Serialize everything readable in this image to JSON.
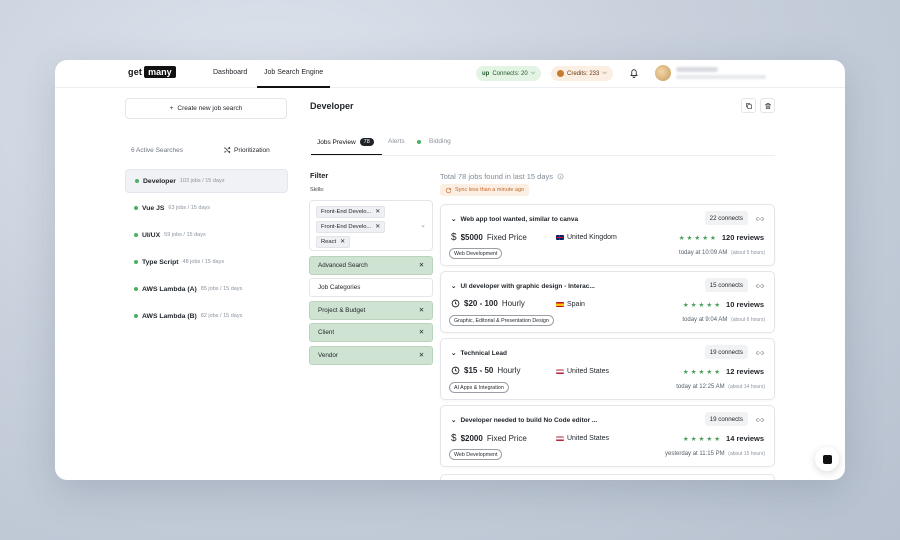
{
  "header": {
    "logo_get": "get",
    "logo_many": "many",
    "nav": [
      "Dashboard",
      "Job Search Engine"
    ],
    "connects": {
      "badge": "up",
      "label": "Connects: 20"
    },
    "credits": {
      "label": "Credits: 233"
    }
  },
  "sidebar": {
    "create_label": "Create new job search",
    "active_label": "6 Active Searches",
    "prioritization_label": "Prioritization",
    "items": [
      {
        "name": "Developer",
        "meta": "103 jobs / 15 days"
      },
      {
        "name": "Vue JS",
        "meta": "63 jobs / 15 days"
      },
      {
        "name": "UI/UX",
        "meta": "59 jobs / 15 days"
      },
      {
        "name": "Type Script",
        "meta": "48 jobs / 15 days"
      },
      {
        "name": "AWS Lambda (A)",
        "meta": "85 jobs / 15 days"
      },
      {
        "name": "AWS Lambda (B)",
        "meta": "82 jobs / 15 days"
      }
    ]
  },
  "main": {
    "title": "Developer",
    "tabs": {
      "jobs_preview": "Jobs Preview",
      "jobs_count": "78",
      "alerts": "Alerts",
      "bidding": "Bidding"
    }
  },
  "filter": {
    "title": "Filter",
    "skills_label": "Skills:",
    "chips": [
      "Front-End Develo...",
      "Front-End Develo...",
      "React"
    ],
    "rows": [
      {
        "label": "Advanced Search",
        "active": true
      },
      {
        "label": "Job Categories",
        "active": false
      },
      {
        "label": "Project & Budget",
        "active": true
      },
      {
        "label": "Client",
        "active": true
      },
      {
        "label": "Vendor",
        "active": true
      }
    ]
  },
  "jobs": {
    "total_label": "Total 78 jobs found in last 15 days",
    "sync_label": "Sync less than a minute ago",
    "list": [
      {
        "title": "Web app tool wanted, similar to canva",
        "connects": "22 connects",
        "price": "$5000",
        "price_type": "Fixed Price",
        "price_icon": "dollar-icon",
        "country": "United Kingdom",
        "flag": "uk",
        "reviews": "120 reviews",
        "category": "Web Development",
        "time": "today at 10:09 AM",
        "ago": "(about 5 hours)"
      },
      {
        "title": "UI developer with graphic design - Interac...",
        "connects": "15 connects",
        "price": "$20 - 100",
        "price_type": "Hourly",
        "price_icon": "clock-icon",
        "country": "Spain",
        "flag": "es",
        "reviews": "10 reviews",
        "category": "Graphic, Editorial & Presentation Design",
        "time": "today at 9:04 AM",
        "ago": "(about 6 hours)"
      },
      {
        "title": "Technical Lead",
        "connects": "19 connects",
        "price": "$15 - 50",
        "price_type": "Hourly",
        "price_icon": "clock-icon",
        "country": "United States",
        "flag": "us",
        "reviews": "12 reviews",
        "category": "AI Apps & Integration",
        "time": "today at 12:25 AM",
        "ago": "(about 14 hours)"
      },
      {
        "title": "Developer needed to build No Code editor ...",
        "connects": "19 connects",
        "price": "$2000",
        "price_type": "Fixed Price",
        "price_icon": "dollar-icon",
        "country": "United States",
        "flag": "us",
        "reviews": "14 reviews",
        "category": "Web Development",
        "time": "yesterday at 11:15 PM",
        "ago": "(about 15 hours)"
      }
    ]
  },
  "colors": {
    "accent_green": "#4caf62",
    "active_filter": "#cfe3d2",
    "star": "#4a9e5c",
    "sync": "#c4682a"
  }
}
